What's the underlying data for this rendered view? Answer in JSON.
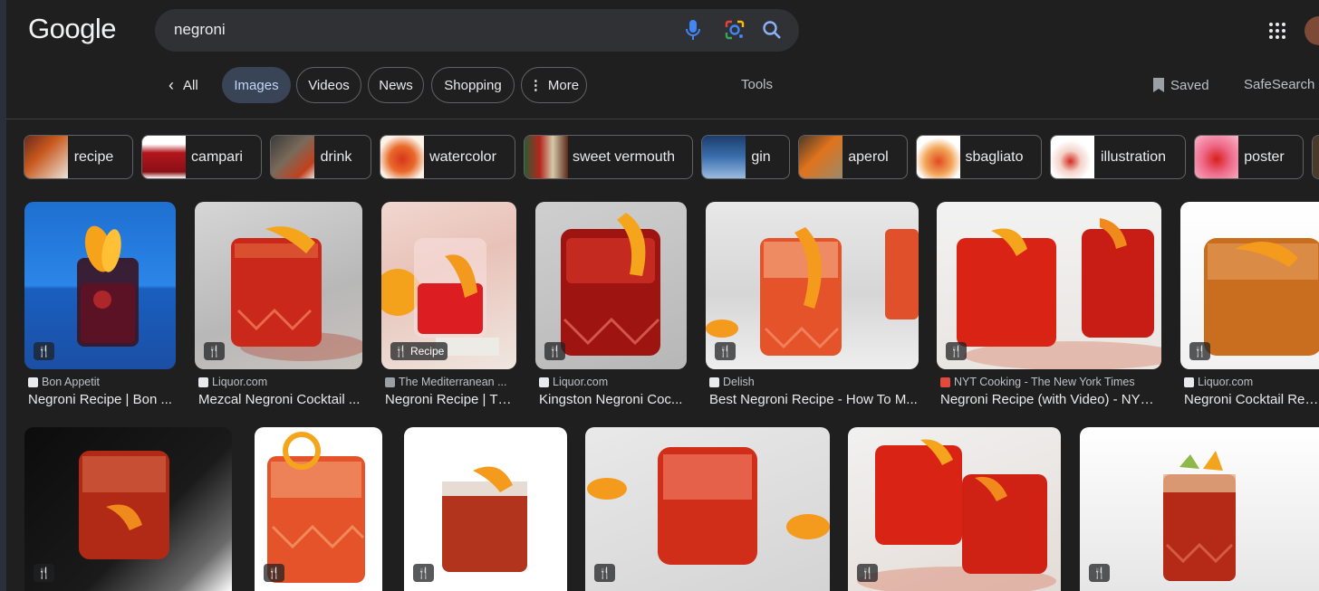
{
  "header": {
    "logo": "Google",
    "query": "negroni",
    "icons": [
      "mic-icon",
      "lens-icon",
      "search-icon",
      "apps-icon"
    ]
  },
  "nav": {
    "back_icon": "chevron-left-icon",
    "all": "All",
    "images": "Images",
    "videos": "Videos",
    "news": "News",
    "shopping": "Shopping",
    "more_icon": "more-vert-icon",
    "more": "More",
    "tools": "Tools",
    "saved": "Saved",
    "safesearch": "SafeSearch"
  },
  "chips": [
    "recipe",
    "campari",
    "drink",
    "watercolor",
    "sweet vermouth",
    "gin",
    "aperol",
    "sbagliato",
    "illustration",
    "poster"
  ],
  "results_row1": [
    {
      "source": "Bon Appetit",
      "title": "Negroni Recipe | Bon ...",
      "badge": ""
    },
    {
      "source": "Liquor.com",
      "title": "Mezcal Negroni Cocktail ...",
      "badge": ""
    },
    {
      "source": "The Mediterranean ...",
      "title": "Negroni Recipe | Th...",
      "badge": "Recipe"
    },
    {
      "source": "Liquor.com",
      "title": "Kingston Negroni Coc...",
      "badge": ""
    },
    {
      "source": "Delish",
      "title": "Best Negroni Recipe - How To M...",
      "badge": ""
    },
    {
      "source": "NYT Cooking - The New York Times",
      "title": "Negroni Recipe (with Video) - NYT ...",
      "badge": ""
    },
    {
      "source": "Liquor.com",
      "title": "Negroni Cocktail Reci...",
      "badge": ""
    }
  ],
  "badge_icon": "fork-knife-icon",
  "colors": {
    "background": "#1f1f1f",
    "searchbar": "#303134",
    "active_tab": "#394457",
    "text": "#e8eaed",
    "drink_red": "#c8281c",
    "orange": "#f39a1e"
  }
}
